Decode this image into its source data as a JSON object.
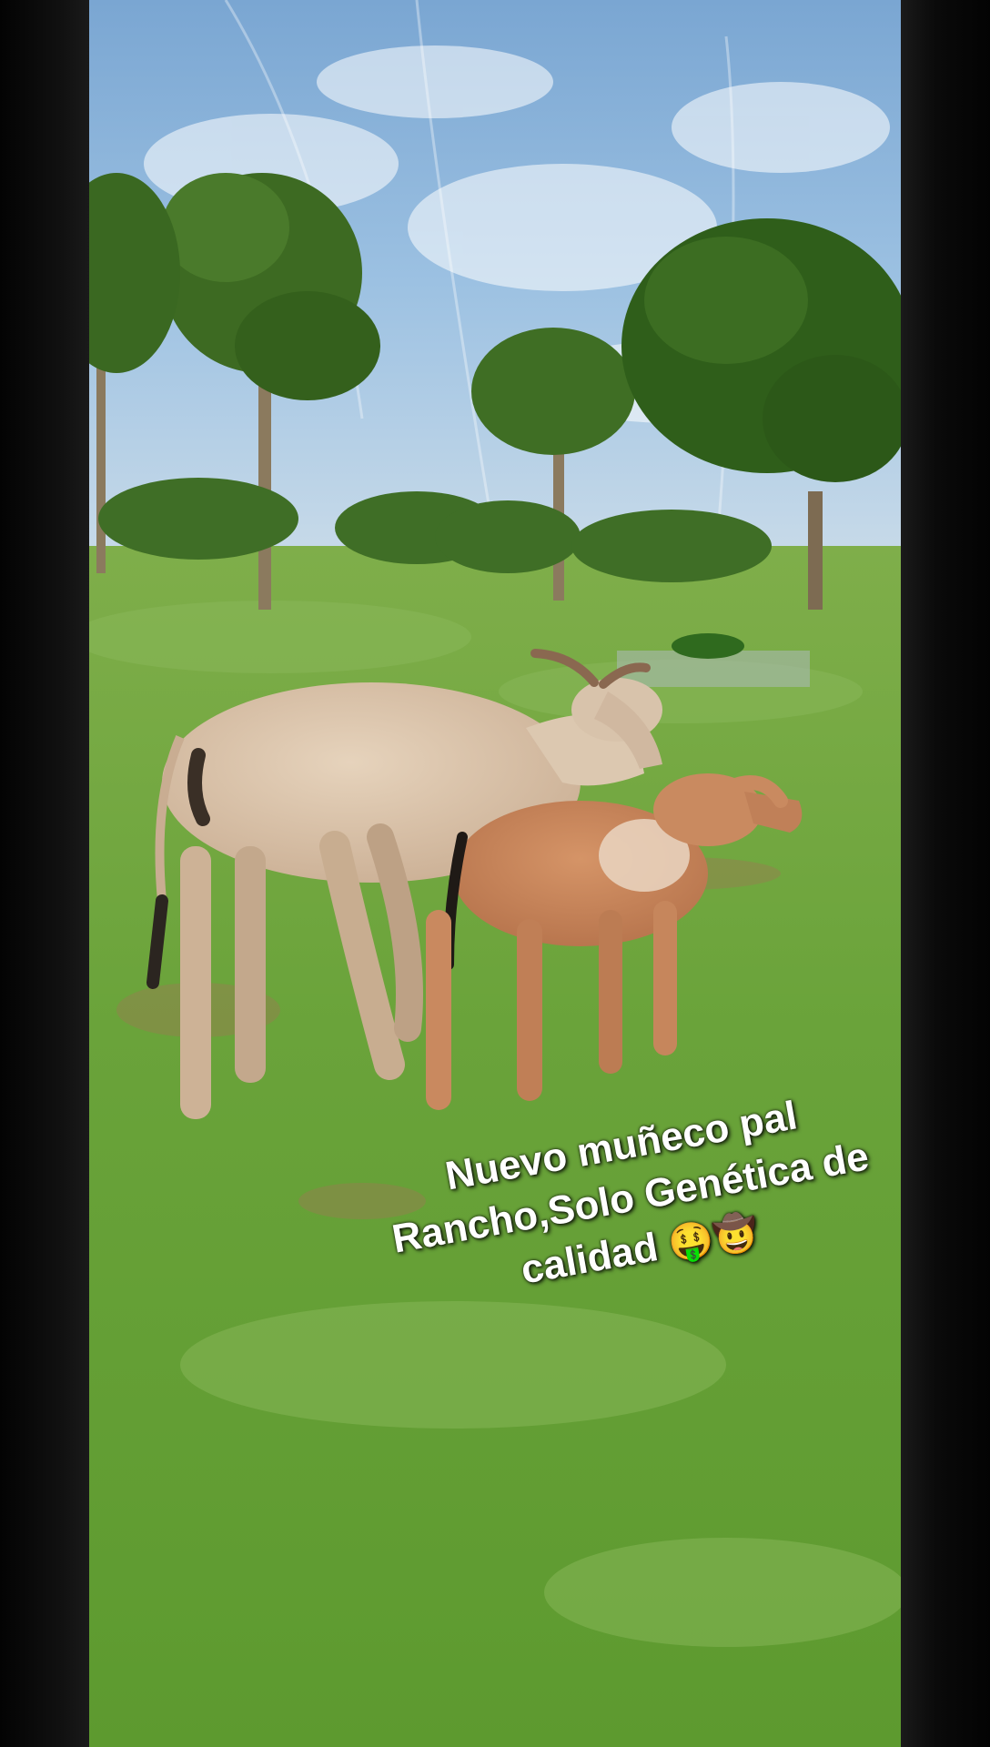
{
  "post": {
    "caption_line1": "Nuevo muñeco pal",
    "caption_line2": "Rancho,Solo Genética de",
    "caption_line3": "calidad",
    "emoji_1": "🤑",
    "emoji_2": "🤠"
  },
  "colors": {
    "sky": "#8fb8dc",
    "grass": "#6aa33a",
    "tree": "#3d6a22",
    "cow": "#d7c1a7",
    "calf": "#c4835a"
  },
  "icons": [
    "money-mouth-face-emoji",
    "cowboy-hat-face-emoji"
  ]
}
